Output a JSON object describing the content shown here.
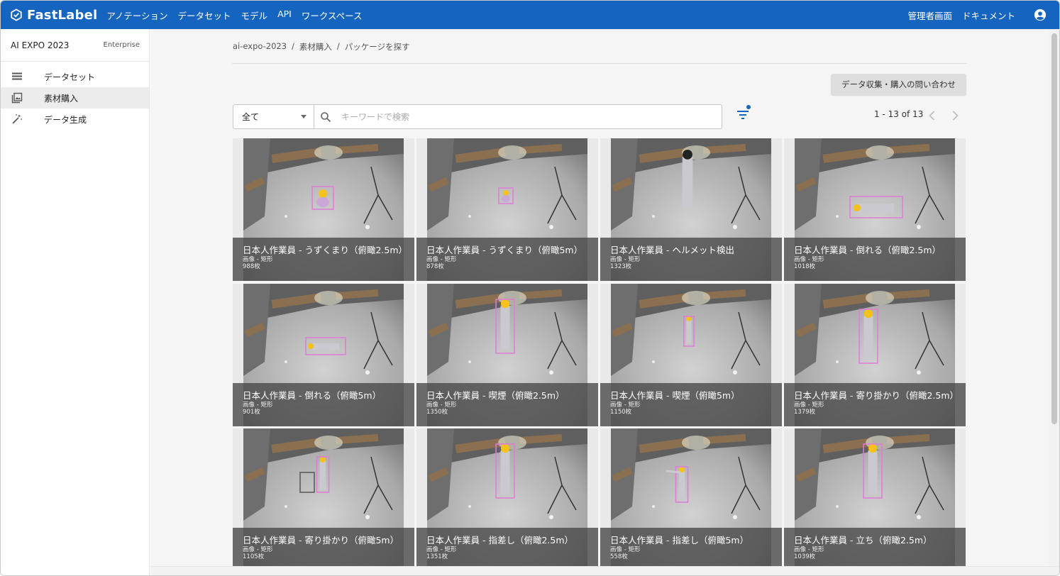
{
  "app": {
    "brand": "FastLabel",
    "nav": [
      "アノテーション",
      "データセット",
      "モデル",
      "API",
      "ワークスペース"
    ],
    "nav_right": [
      "管理者画面",
      "ドキュメント"
    ]
  },
  "sidebar": {
    "workspace_name": "AI EXPO 2023",
    "plan": "Enterprise",
    "items": [
      {
        "label": "データセット",
        "icon": "list-icon",
        "active": false
      },
      {
        "label": "素材購入",
        "icon": "gallery-icon",
        "active": true
      },
      {
        "label": "データ生成",
        "icon": "magic-wand-icon",
        "active": false
      }
    ]
  },
  "breadcrumb": [
    "ai-expo-2023",
    "/",
    "素材購入",
    "/",
    "パッケージを探す"
  ],
  "contact_button": "データ収集・購入の問い合わせ",
  "filter": {
    "select_value": "全て",
    "search_placeholder": "キーワードで検索",
    "search_value": ""
  },
  "pagination": {
    "label": "1 - 13 of 13"
  },
  "cards": [
    {
      "title": "日本人作業員 - うずくまり（俯瞰2.5m）",
      "type": "画像 - 矩形",
      "count": "988枚",
      "pose": "crouch"
    },
    {
      "title": "日本人作業員 - うずくまり（俯瞰5m）",
      "type": "画像 - 矩形",
      "count": "878枚",
      "pose": "crouch-small"
    },
    {
      "title": "日本人作業員 - ヘルメット検出",
      "type": "画像 - 矩形",
      "count": "1323枚",
      "pose": "stand-plain"
    },
    {
      "title": "日本人作業員 - 倒れる（俯瞰2.5m）",
      "type": "画像 - 矩形",
      "count": "1018枚",
      "pose": "lying"
    },
    {
      "title": "日本人作業員 - 倒れる（俯瞰5m）",
      "type": "画像 - 矩形",
      "count": "901枚",
      "pose": "lying-small"
    },
    {
      "title": "日本人作業員 - 喫煙（俯瞰2.5m）",
      "type": "画像 - 矩形",
      "count": "1350枚",
      "pose": "stand"
    },
    {
      "title": "日本人作業員 - 喫煙（俯瞰5m）",
      "type": "画像 - 矩形",
      "count": "1150枚",
      "pose": "stand-small"
    },
    {
      "title": "日本人作業員 - 寄り掛かり（俯瞰2.5m）",
      "type": "画像 - 矩形",
      "count": "1379枚",
      "pose": "lean"
    },
    {
      "title": "日本人作業員 - 寄り掛かり（俯瞰5m）",
      "type": "画像 - 矩形",
      "count": "1105枚",
      "pose": "lean-rail"
    },
    {
      "title": "日本人作業員 - 指差し（俯瞰2.5m）",
      "type": "画像 - 矩形",
      "count": "1351枚",
      "pose": "stand"
    },
    {
      "title": "日本人作業員 - 指差し（俯瞰5m）",
      "type": "画像 - 矩形",
      "count": "558枚",
      "pose": "point"
    },
    {
      "title": "日本人作業員 - 立ち（俯瞰2.5m）",
      "type": "画像 - 矩形",
      "count": "1039枚",
      "pose": "stand"
    }
  ],
  "colors": {
    "header": "#1565c0",
    "bbox": "#e07bd6",
    "helmet": "#f4c21a"
  }
}
